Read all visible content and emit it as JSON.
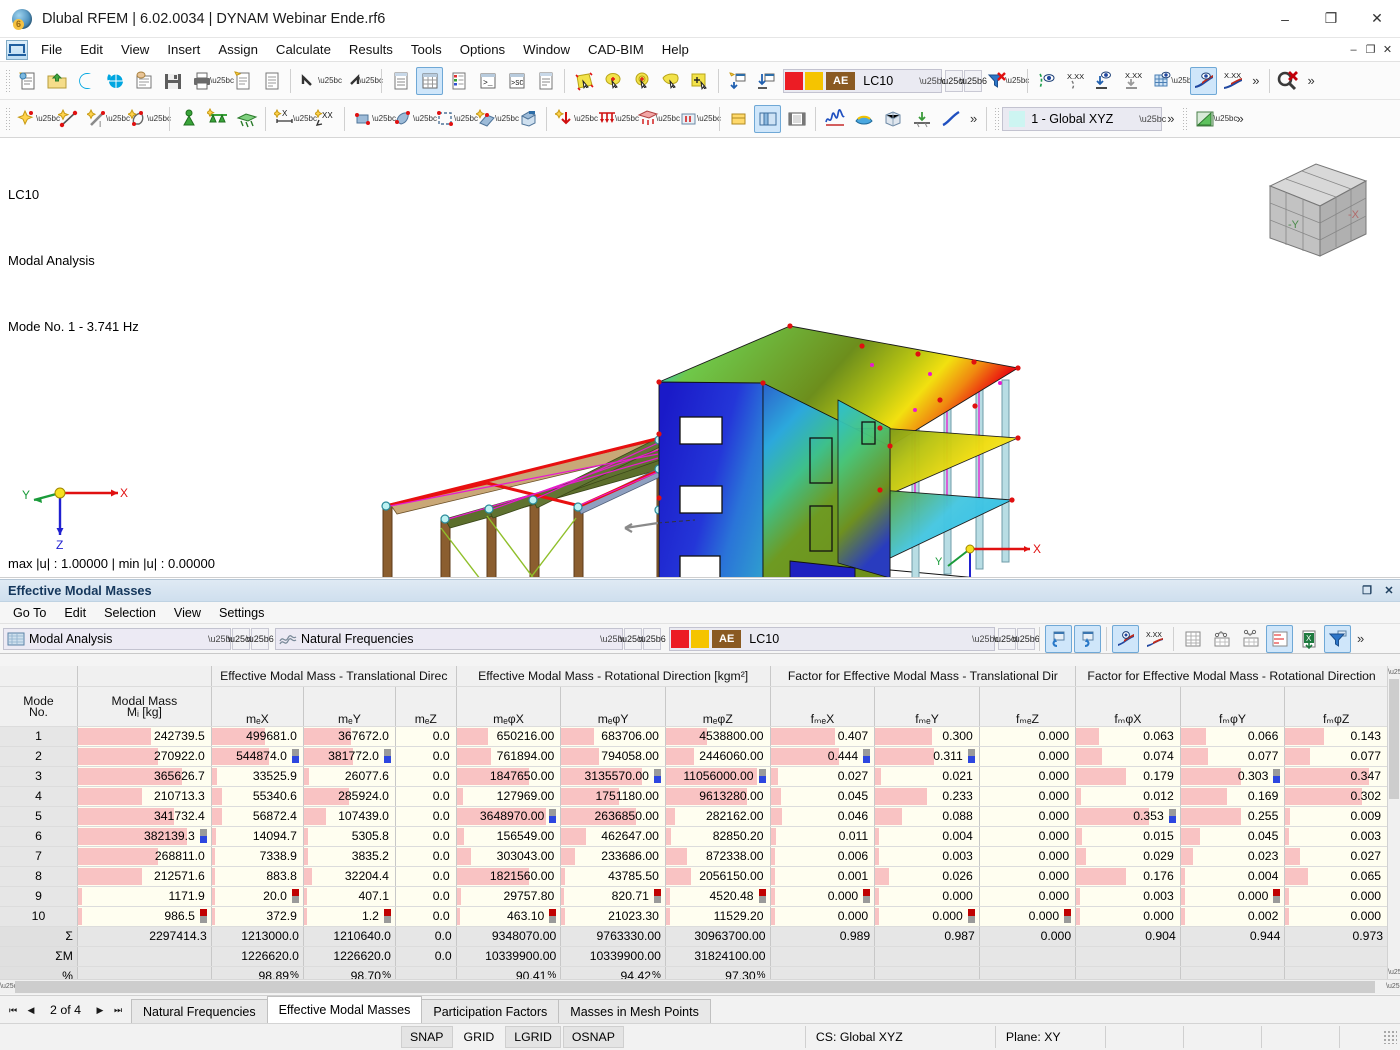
{
  "window": {
    "title": "Dlubal RFEM | 6.02.0034 | DYNAM Webinar Ende.rf6",
    "app_icon": "rfem-logo-icon",
    "minimize": "–",
    "maximize": "❐",
    "close": "✕"
  },
  "menubar": {
    "items": [
      "File",
      "Edit",
      "View",
      "Insert",
      "Assign",
      "Calculate",
      "Results",
      "Tools",
      "Options",
      "Window",
      "CAD-BIM",
      "Help"
    ],
    "window_controls": [
      "–",
      "❐",
      "✕"
    ]
  },
  "toolbar1": {
    "load_case": {
      "ae_label": "AE",
      "value": "LC10",
      "color_red": "#ec1c24",
      "color_yellow": "#f5c400"
    },
    "overflow": "»"
  },
  "toolbar2": {
    "coordinate_system": {
      "value": "1 - Global XYZ",
      "swatch": "#cdf5f2"
    },
    "overflow": "»"
  },
  "viewport": {
    "info_line1": "LC10",
    "info_line2": "Modal Analysis",
    "info_line3": "Mode No. 1 - 3.741 Hz",
    "min_max": "max |u| : 1.00000 | min |u| : 0.00000",
    "axis_x": "X",
    "axis_y": "Y",
    "axis_z": "Z",
    "cube_face_left": "-Y",
    "cube_face_right": "-X"
  },
  "results_panel": {
    "title": "Effective Modal Masses",
    "title_buttons": [
      "❐",
      "✕"
    ],
    "menus": [
      "Go To",
      "Edit",
      "Selection",
      "View",
      "Settings"
    ],
    "analysis_combo": "Modal Analysis",
    "result_combo": "Natural Frequencies",
    "load_case_combo": "LC10",
    "ae_label": "AE",
    "overflow": "»"
  },
  "table": {
    "groups": [
      {
        "label": "",
        "span": 1
      },
      {
        "label": "",
        "span": 1
      },
      {
        "label": "Effective Modal Mass - Translational Direc",
        "span": 3
      },
      {
        "label": "Effective Modal Mass - Rotational Direction [kgm²]",
        "span": 3
      },
      {
        "label": "Factor for Effective Modal Mass - Translational Dir",
        "span": 3
      },
      {
        "label": "Factor for Effective Modal Mass - Rotational Direction",
        "span": 3
      }
    ],
    "header_mode_line1": "Mode",
    "header_mode_line2": "No.",
    "header_modal_line1": "Modal Mass",
    "header_modal_line2": "Mᵢ [kg]",
    "subheaders": [
      "mₑX",
      "mₑY",
      "mₑZ",
      "mₑφX",
      "mₑφY",
      "mₑφZ",
      "fₘₑX",
      "fₘₑY",
      "fₘₑZ",
      "fₘφX",
      "fₘφY",
      "fₘφZ"
    ],
    "rows": [
      {
        "mode": "1",
        "cells": [
          "242739.5",
          "499681.0",
          "367672.0",
          "0.0",
          "650216.00",
          "683706.00",
          "4538800.00",
          "0.407",
          "0.300",
          "0.000",
          "0.063",
          "0.066",
          "0.143"
        ],
        "bars": [
          55,
          58,
          52,
          0,
          30,
          32,
          40,
          62,
          55,
          0,
          22,
          24,
          38
        ],
        "flags": [
          null,
          null,
          null,
          null,
          null,
          null,
          null,
          null,
          null,
          null,
          null,
          null,
          null
        ]
      },
      {
        "mode": "2",
        "cells": [
          "270922.0",
          "544874.0",
          "381772.0",
          "0.0",
          "761894.00",
          "794058.00",
          "2446060.00",
          "0.444",
          "0.311",
          "0.000",
          "0.074",
          "0.077",
          "0.077"
        ],
        "bars": [
          60,
          63,
          54,
          0,
          33,
          36,
          27,
          66,
          57,
          0,
          25,
          26,
          24
        ],
        "flags": [
          null,
          "bluegray",
          "bluegray",
          null,
          null,
          null,
          null,
          "bluegray",
          "bluegray",
          null,
          null,
          null,
          null
        ]
      },
      {
        "mode": "3",
        "cells": [
          "365626.7",
          "33525.9",
          "26077.6",
          "0.0",
          "1847650.00",
          "3135570.00",
          "11056000.00",
          "0.027",
          "0.021",
          "0.000",
          "0.179",
          "0.303",
          "0.347"
        ],
        "bars": [
          78,
          6,
          6,
          0,
          70,
          78,
          88,
          7,
          6,
          0,
          48,
          58,
          82
        ],
        "flags": [
          null,
          null,
          null,
          null,
          null,
          "bluegray",
          "bluegray",
          null,
          null,
          null,
          null,
          "bluegray",
          null
        ]
      },
      {
        "mode": "4",
        "cells": [
          "210713.3",
          "55340.6",
          "285924.0",
          "0.0",
          "127969.00",
          "1751180.00",
          "9613280.00",
          "0.045",
          "0.233",
          "0.000",
          "0.012",
          "0.169",
          "0.302"
        ],
        "bars": [
          48,
          11,
          50,
          0,
          6,
          56,
          78,
          10,
          50,
          0,
          5,
          45,
          75
        ],
        "flags": [
          null,
          null,
          null,
          null,
          null,
          null,
          null,
          null,
          null,
          null,
          null,
          null,
          null
        ]
      },
      {
        "mode": "5",
        "cells": [
          "341732.4",
          "56872.4",
          "107439.0",
          "0.0",
          "3648970.00",
          "2636850.00",
          "282162.00",
          "0.046",
          "0.088",
          "0.000",
          "0.353",
          "0.255",
          "0.009"
        ],
        "bars": [
          72,
          11,
          24,
          0,
          86,
          72,
          9,
          11,
          26,
          0,
          70,
          58,
          5
        ],
        "flags": [
          null,
          null,
          null,
          null,
          "bluegray",
          null,
          null,
          null,
          null,
          null,
          "bluegray",
          null,
          null
        ]
      },
      {
        "mode": "6",
        "cells": [
          "382139.3",
          "14094.7",
          "5305.8",
          "0.0",
          "156549.00",
          "462647.00",
          "82850.20",
          "0.011",
          "0.004",
          "0.000",
          "0.015",
          "0.045",
          "0.003"
        ],
        "bars": [
          82,
          5,
          4,
          0,
          7,
          24,
          5,
          5,
          4,
          0,
          6,
          19,
          4
        ],
        "flags": [
          "bluegray",
          null,
          null,
          null,
          null,
          null,
          null,
          null,
          null,
          null,
          null,
          null,
          null
        ]
      },
      {
        "mode": "7",
        "cells": [
          "268811.0",
          "7338.9",
          "3835.2",
          "0.0",
          "303043.00",
          "233686.00",
          "872338.00",
          "0.006",
          "0.003",
          "0.000",
          "0.029",
          "0.023",
          "0.027"
        ],
        "bars": [
          60,
          4,
          4,
          0,
          14,
          13,
          20,
          4,
          4,
          0,
          10,
          12,
          14
        ],
        "flags": [
          null,
          null,
          null,
          null,
          null,
          null,
          null,
          null,
          null,
          null,
          null,
          null,
          null
        ]
      },
      {
        "mode": "8",
        "cells": [
          "212571.6",
          "883.8",
          "32204.4",
          "0.0",
          "1821560.00",
          "43785.50",
          "2056150.00",
          "0.001",
          "0.026",
          "0.000",
          "0.176",
          "0.004",
          "0.065"
        ],
        "bars": [
          48,
          3,
          9,
          0,
          70,
          4,
          24,
          4,
          13,
          0,
          48,
          4,
          22
        ],
        "flags": [
          null,
          null,
          null,
          null,
          null,
          null,
          null,
          null,
          null,
          null,
          null,
          null,
          null
        ]
      },
      {
        "mode": "9",
        "cells": [
          "1171.9",
          "20.0",
          "407.1",
          "0.0",
          "29757.80",
          "820.71",
          "4520.48",
          "0.000",
          "0.000",
          "0.000",
          "0.003",
          "0.000",
          "0.000"
        ],
        "bars": [
          3,
          3,
          3,
          0,
          4,
          3,
          4,
          4,
          4,
          0,
          4,
          4,
          4
        ],
        "flags": [
          null,
          "redgray",
          null,
          null,
          null,
          "redgray",
          "redgray",
          "redgray",
          null,
          null,
          null,
          "redgray",
          null
        ]
      },
      {
        "mode": "10",
        "cells": [
          "986.5",
          "372.9",
          "1.2",
          "0.0",
          "463.10",
          "21023.30",
          "11529.20",
          "0.000",
          "0.000",
          "0.000",
          "0.000",
          "0.002",
          "0.000"
        ],
        "bars": [
          3,
          3,
          3,
          0,
          3,
          4,
          4,
          4,
          4,
          0,
          4,
          4,
          4
        ],
        "flags": [
          "redgray",
          null,
          "redgray",
          null,
          "redgray",
          null,
          null,
          null,
          "redgray",
          "redgray",
          null,
          null,
          null
        ]
      }
    ],
    "sum_row": {
      "label": "Σ",
      "cells": [
        "2297414.3",
        "1213000.0",
        "1210640.0",
        "0.0",
        "9348070.00",
        "9763330.00",
        "30963700.00",
        "0.989",
        "0.987",
        "0.000",
        "0.904",
        "0.944",
        "0.973"
      ]
    },
    "sum_m_row": {
      "label": "ΣM",
      "cells": [
        "",
        "1226620.0",
        "1226620.0",
        "0.0",
        "10339900.00",
        "10339900.00",
        "31824100.00",
        "",
        "",
        "",
        "",
        "",
        ""
      ]
    },
    "pct_row": {
      "label": "%",
      "cells": [
        "",
        "98.89",
        "98.70",
        "",
        "90.41",
        "94.42",
        "97.30",
        "",
        "",
        "",
        "",
        "",
        ""
      ],
      "symbol": "%"
    }
  },
  "bottom_tabs": {
    "pager": "2 of 4",
    "pager_buttons": [
      "⏮",
      "◀",
      "▶",
      "⏭"
    ],
    "tabs": [
      {
        "label": "Natural Frequencies",
        "active": false
      },
      {
        "label": "Effective Modal Masses",
        "active": true
      },
      {
        "label": "Participation Factors",
        "active": false
      },
      {
        "label": "Masses in Mesh Points",
        "active": false
      }
    ]
  },
  "statusbar": {
    "toggles": [
      {
        "label": "SNAP",
        "on": true
      },
      {
        "label": "GRID",
        "on": false
      },
      {
        "label": "LGRID",
        "on": true
      },
      {
        "label": "OSNAP",
        "on": true
      }
    ],
    "coord_system": "CS: Global XYZ",
    "plane": "Plane: XY"
  }
}
